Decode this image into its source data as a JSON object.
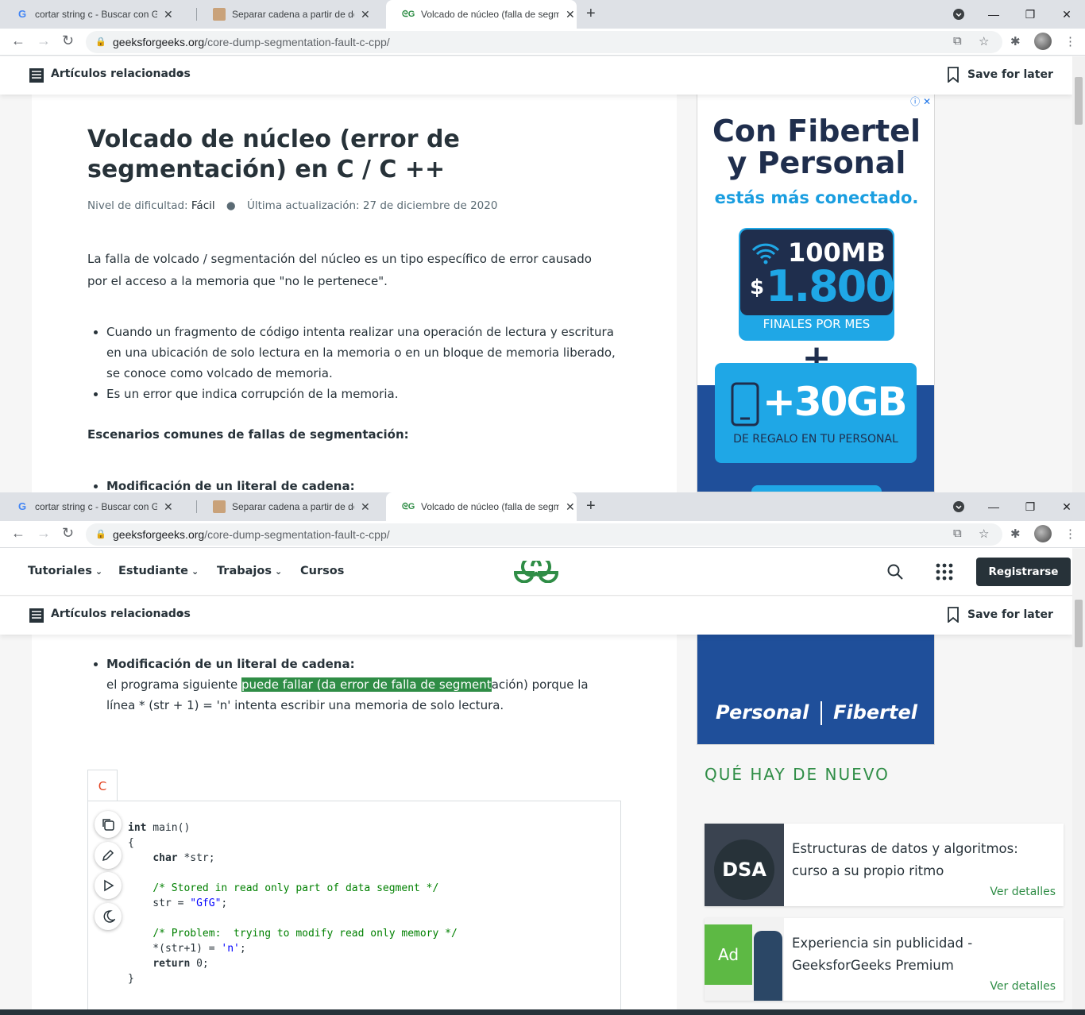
{
  "tabs": [
    {
      "title": "cortar string c - Buscar con Goog",
      "icon": "google-icon"
    },
    {
      "title": "Separar cadena a partir de delimi",
      "icon": "user-avatar-icon"
    },
    {
      "title": "Volcado de núcleo (falla de segm",
      "icon": "gfg-icon"
    }
  ],
  "address": {
    "host": "geeksforgeeks.org",
    "path": "/core-dump-segmentation-fault-c-cpp/"
  },
  "related_bar": {
    "label": "Artículos relacionados",
    "save": "Save for later"
  },
  "nav": {
    "items": [
      "Tutoriales",
      "Estudiante",
      "Trabajos",
      "Cursos"
    ],
    "register": "Registrarse"
  },
  "article": {
    "title": "Volcado de núcleo (error de segmentación) en C / C ++",
    "difficulty_label": "Nivel de dificultad:",
    "difficulty": "Fácil",
    "updated": "Última actualización: 27 de diciembre de 2020",
    "intro_1": "La falla de volcado / segmentación del núcleo es un tipo específico de error causado",
    "intro_2": "por el acceso a la memoria que \"no le pertenece\".",
    "bullet1_1": "Cuando un fragmento de código intenta realizar una operación de lectura y escritura",
    "bullet1_2": "en una ubicación de solo lectura en la memoria o en un bloque de memoria liberado,",
    "bullet1_3": "se conoce como volcado de memoria.",
    "bullet2": "Es un error que indica corrupción de la memoria.",
    "scenarios": "Escenarios comunes de fallas de segmentación:",
    "mod_heading": "Modificación de un literal de cadena:",
    "mod_1a": "el programa siguiente ",
    "mod_1b": "puede fallar (da error de falla de segment",
    "mod_1c": "ación) porque la",
    "mod_2": "línea * (str + 1) = 'n' intenta escribir una memoria de solo lectura.",
    "code_lang": "C"
  },
  "ad": {
    "line1": "Con Fibertel",
    "line2": "y Personal",
    "line3": "estás más conectado.",
    "speed": "100MB",
    "currency": "$",
    "price": "1.800",
    "per": "FINALES POR MES",
    "plus": "+",
    "gb": "+30GB",
    "gift": "DE REGALO EN TU PERSONAL",
    "brand1": "Personal",
    "brand2": "Fibertel"
  },
  "news": {
    "heading": "QUÉ HAY DE NUEVO",
    "cards": [
      {
        "title": "Estructuras de datos y algoritmos: curso a su propio ritmo",
        "link": "Ver detalles",
        "thumb": "DSA"
      },
      {
        "title": "Experiencia sin publicidad - GeeksforGeeks Premium",
        "link": "Ver detalles",
        "thumb": "Ad"
      }
    ]
  }
}
